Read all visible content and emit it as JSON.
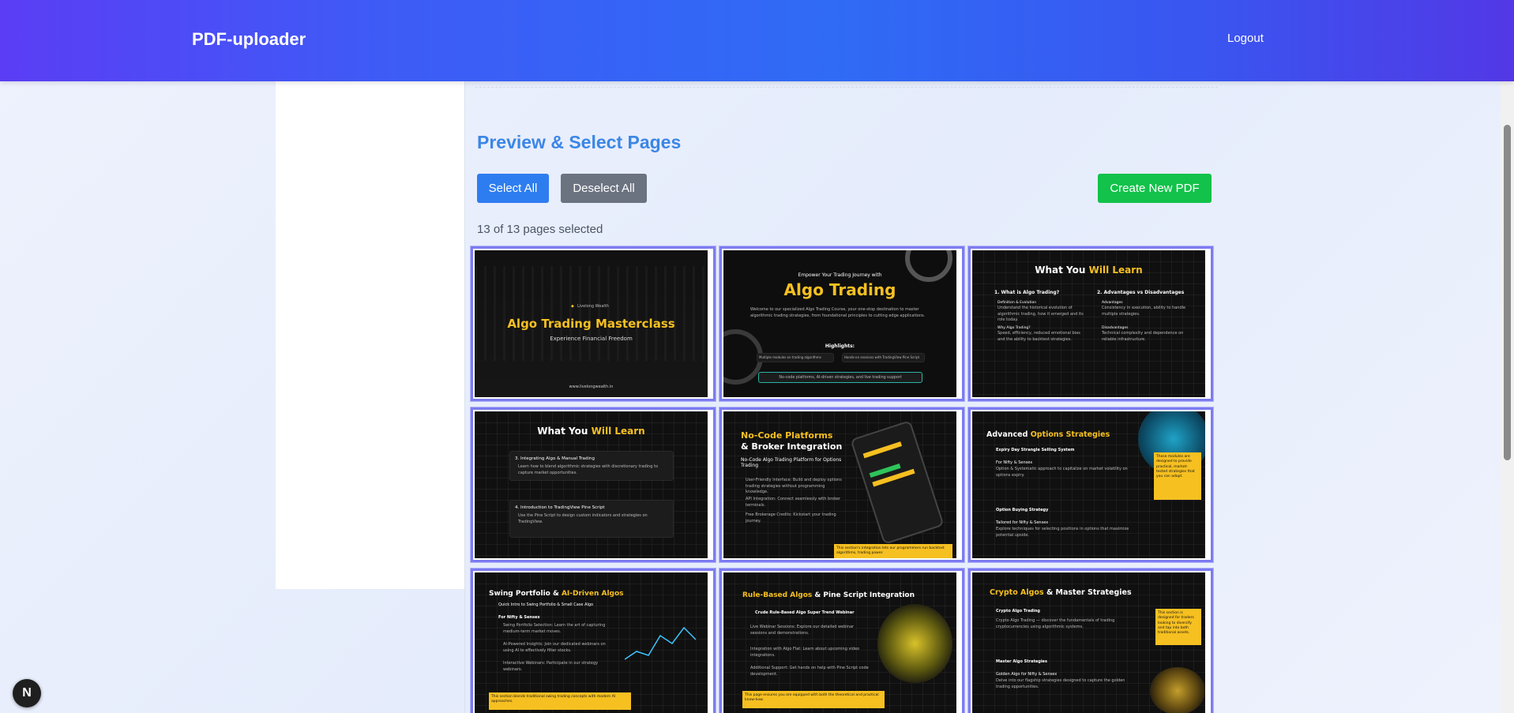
{
  "header": {
    "brand": "PDF-uploader",
    "logout_label": "Logout"
  },
  "main": {
    "title": "Preview & Select Pages",
    "select_all_label": "Select All",
    "deselect_all_label": "Deselect All",
    "create_pdf_label": "Create New PDF",
    "selection_status": "13 of 13 pages selected"
  },
  "slides": [
    {
      "title": "Algo Trading Masterclass",
      "subtitle": "Experience Financial Freedom",
      "brand": "Livelong Wealth",
      "footer": "www.livelongwealth.in"
    },
    {
      "kicker": "Empower Your Trading Journey with",
      "title": "Algo Trading",
      "highlights_label": "Highlights:",
      "pill1": "Multiple modules on trading algorithms",
      "pill2": "Hands-on sessions with TradingView Pine Script",
      "pill3": "No-code platforms, AI-driven strategies, and live trading support"
    },
    {
      "title_a": "What You ",
      "title_b": "Will Learn",
      "col1": "1. What is Algo Trading?",
      "col2": "2. Advantages vs Disadvantages",
      "sub1": "Definition & Evolution",
      "sub2": "Why Algo Trading?",
      "sub3": "Advantages",
      "sub4": "Disadvantages"
    },
    {
      "title_a": "What You ",
      "title_b": "Will Learn",
      "item1": "3. Integrating Algo & Manual Trading",
      "item2": "4. Introduction to TradingView Pine Script"
    },
    {
      "title_a": "No-Code Platforms",
      "title_b": "& Broker Integration",
      "sub": "No-Code Algo Trading Platform for Options Trading"
    },
    {
      "title_a": "Advanced ",
      "title_b": "Options Strategies",
      "sub1": "Expiry Day Strangle Selling System",
      "sub2": "For Nifty & Sensex",
      "sub3": "Option Buying Strategy",
      "sub4": "Tailored for Nifty & Sensex"
    },
    {
      "title_a": "Swing Portfolio & ",
      "title_b": "AI-Driven Algos",
      "sub": "Quick Intro to Swing Portfolio & Small Case Algo",
      "sub2": "For Nifty & Sensex"
    },
    {
      "title_a": "Rule-Based Algos ",
      "title_b": "& Pine Script Integration",
      "sub": "Crude Rule-Based Algo Super Trend Webinar"
    },
    {
      "title_a": "Crypto Algos ",
      "title_b": "& Master Strategies",
      "sub1": "Crypto Algo Trading",
      "sub2": "Master Algo Strategies",
      "sub3": "Golden Algo for Nifty & Sensex"
    }
  ],
  "badge": {
    "letter": "N"
  }
}
